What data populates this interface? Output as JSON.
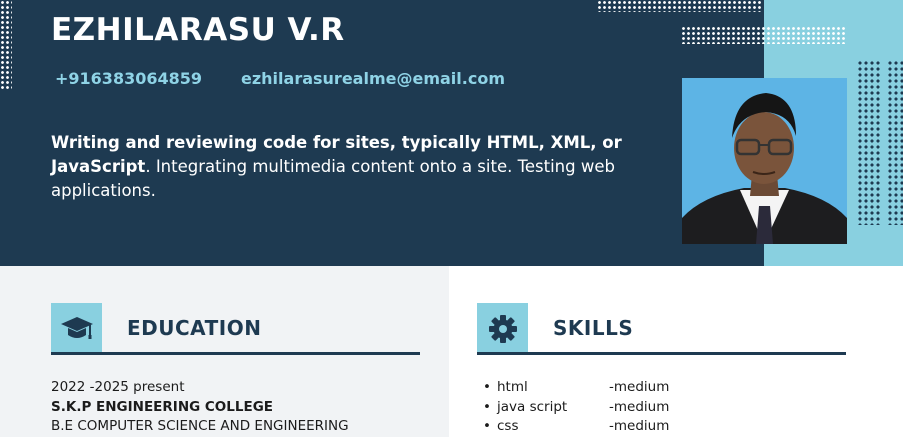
{
  "profile": {
    "name": "EZHILARASU V.R",
    "phone": "+916383064859",
    "email": "ezhilarasurealme@email.com",
    "summary_bold": "Writing and reviewing code for sites, typically HTML, XML, or JavaScript",
    "summary_rest": ". Integrating multimedia content onto a site. Testing web applications."
  },
  "education": {
    "title": "EDUCATION",
    "icon": "graduation-cap-icon",
    "years": "2022 -2025  present",
    "college": "S.K.P ENGINEERING COLLEGE",
    "degree": " B.E COMPUTER SCIENCE AND ENGINEERING"
  },
  "skills": {
    "title": "SKILLS",
    "icon": "gear-icon",
    "items": [
      {
        "name": "html",
        "level": "-medium"
      },
      {
        "name": "java script",
        "level": "-medium"
      },
      {
        "name": "css",
        "level": "-medium"
      }
    ]
  },
  "colors": {
    "header_bg": "#1e3a51",
    "accent": "#89d0e0",
    "contact": "#8fd3e6",
    "left_panel": "#f1f3f5"
  }
}
